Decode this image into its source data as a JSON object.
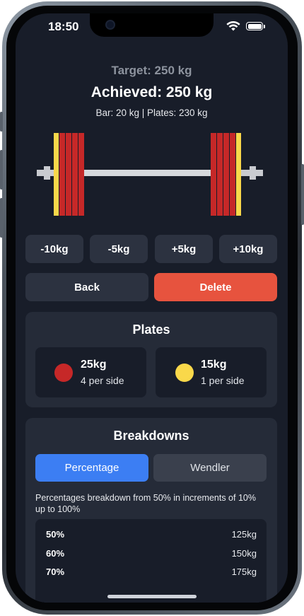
{
  "status_bar": {
    "time": "18:50"
  },
  "summary": {
    "target": "Target: 250 kg",
    "achieved": "Achieved: 250 kg",
    "breakdown": "Bar: 20 kg | Plates: 230 kg"
  },
  "adjust_buttons": [
    "-10kg",
    "-5kg",
    "+5kg",
    "+10kg"
  ],
  "actions": {
    "back": "Back",
    "delete": "Delete"
  },
  "colors": {
    "plate_25": "#c62828",
    "plate_15": "#f9d84a",
    "delete": "#e7533e",
    "tab_active": "#3c7ef3",
    "background": "#181d29",
    "card": "#252b38"
  },
  "plates": {
    "title": "Plates",
    "items": [
      {
        "weight": "25kg",
        "count": "4 per side",
        "color": "#c62828"
      },
      {
        "weight": "15kg",
        "count": "1 per side",
        "color": "#f9d84a"
      }
    ]
  },
  "breakdowns": {
    "title": "Breakdowns",
    "tabs": [
      "Percentage",
      "Wendler"
    ],
    "active_tab": "Percentage",
    "description": "Percentages breakdown from 50% in increments of 10% up to 100%",
    "rows": [
      {
        "percent": "50%",
        "weight": "125kg"
      },
      {
        "percent": "60%",
        "weight": "150kg"
      },
      {
        "percent": "70%",
        "weight": "175kg"
      }
    ]
  }
}
